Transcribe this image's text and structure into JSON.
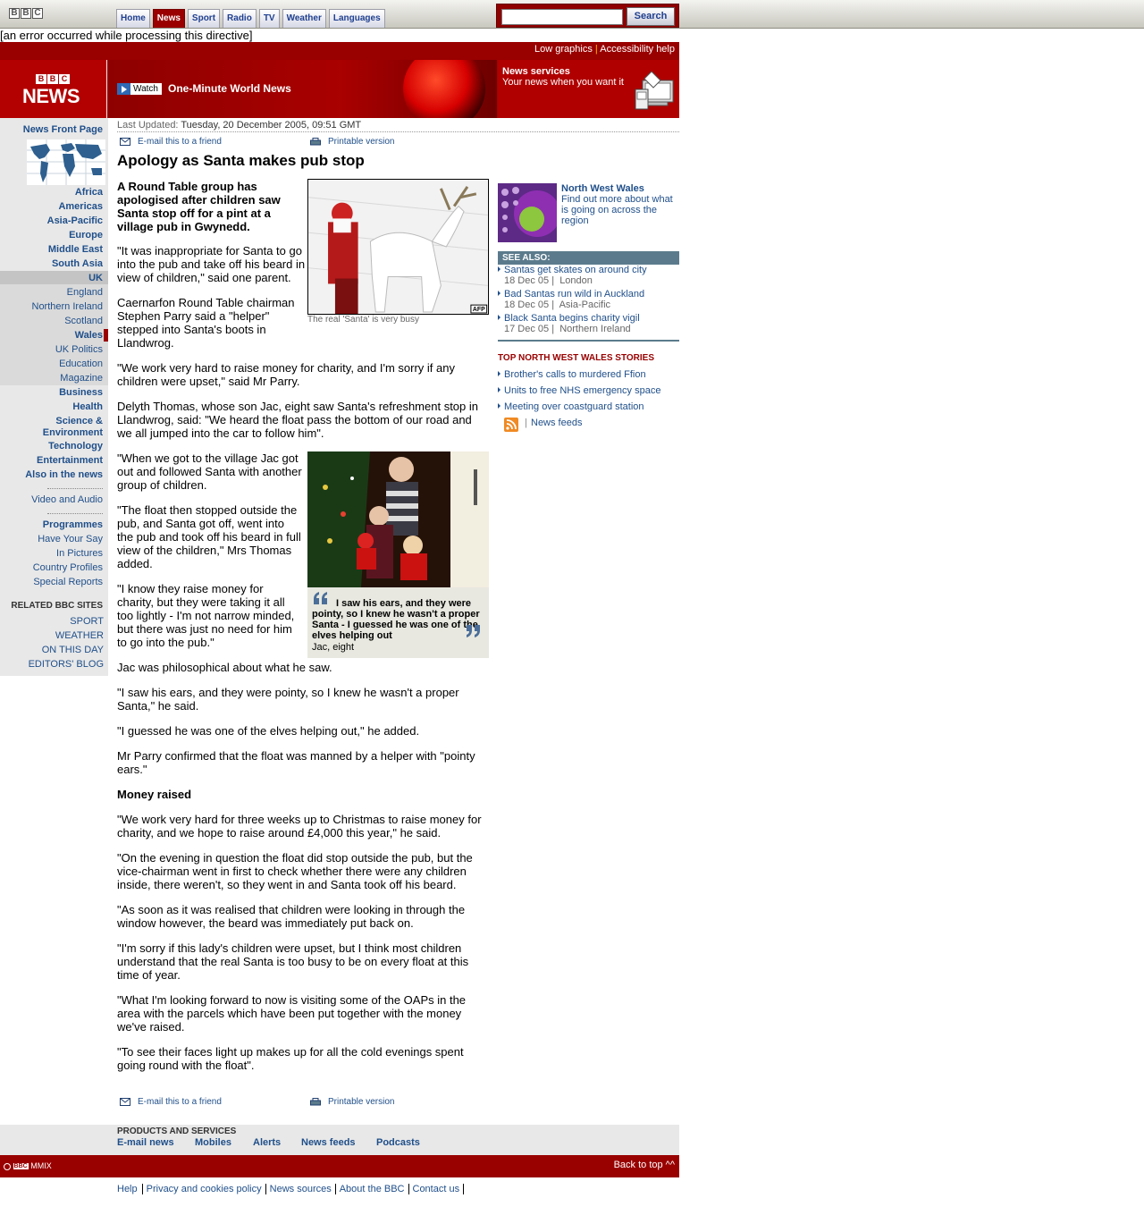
{
  "topnav": {
    "tabs": [
      "Home",
      "News",
      "Sport",
      "Radio",
      "TV",
      "Weather",
      "Languages"
    ],
    "active": "News",
    "search_button": "Search"
  },
  "error_message": "[an error occurred while processing this directive]",
  "utility": {
    "low_graphics": "Low graphics",
    "separator": "|",
    "accessibility": "Accessibility help"
  },
  "masthead": {
    "watch_label": "Watch",
    "watch_title": "One-Minute World News",
    "services_title": "News services",
    "services_sub": "Your news when you want it"
  },
  "leftnav": {
    "front_page": "News Front Page",
    "regions": [
      "Africa",
      "Americas",
      "Asia-Pacific",
      "Europe",
      "Middle East",
      "South Asia",
      "UK"
    ],
    "uk_sub": [
      "England",
      "Northern Ireland",
      "Scotland",
      "Wales",
      "UK Politics",
      "Education",
      "Magazine"
    ],
    "sections": [
      "Business",
      "Health",
      "Science & Environment",
      "Technology",
      "Entertainment",
      "Also in the news"
    ],
    "video_audio": "Video and Audio",
    "programmes": "Programmes",
    "extras": [
      "Have Your Say",
      "In Pictures",
      "Country Profiles",
      "Special Reports"
    ],
    "related_head": "RELATED BBC SITES",
    "related": [
      "SPORT",
      "WEATHER",
      "ON THIS DAY",
      "EDITORS' BLOG"
    ]
  },
  "article": {
    "last_updated_label": "Last Updated:",
    "last_updated": "Tuesday, 20 December 2005, 09:51 GMT",
    "email_link": "E-mail this to a friend",
    "print_link": "Printable version",
    "headline": "Apology as Santa makes pub stop",
    "intro": "A Round Table group has apologised after children saw Santa stop off for a pint at a village pub in Gwynedd.",
    "p1": "\"It was inappropriate for Santa to go into the pub and take off his beard in view of children,\" said one parent.",
    "p2": "Caernarfon Round Table chairman Stephen Parry said a \"helper\" stepped into Santa's boots in Llandwrog.",
    "p3": "\"We work very hard to raise money for charity, and I'm sorry if any children were upset,\" said Mr Parry.",
    "p4": "Delyth Thomas, whose son Jac, eight saw Santa's refreshment stop in Llandwrog, said: \"We heard the float pass the bottom of our road and we all jumped into the car to follow him\".",
    "p5": "\"When we got to the village Jac got out and followed Santa with another group of children.",
    "p6": "\"The float then stopped outside the pub, and Santa got off, went into the pub and took off his beard in full view of the children,\" Mrs Thomas added.",
    "p7": "\"I know they raise money for charity, but they were taking it all too lightly - I'm not narrow minded, but there was just no need for him to go into the pub.\"",
    "p8": "Jac was philosophical about what he saw.",
    "p9": "\"I saw his ears, and they were pointy, so I knew he wasn't a proper Santa,\" he said.",
    "p10": "\"I guessed he was one of the elves helping out,\" he added.",
    "p11": "Mr Parry confirmed that the float was manned by a helper with \"pointy ears.\"",
    "subhead": "Money raised",
    "p12": "\"We work very hard for three weeks up to Christmas to raise money for charity, and we hope to raise around £4,000 this year,\" he said.",
    "p13": "\"On the evening in question the float did stop outside the pub, but the vice-chairman went in first to check whether there were any children inside, there weren't, so they went in and Santa took off his beard.",
    "p14": "\"As soon as it was realised that children were looking in through the window however, the beard was immediately put back on.",
    "p15": "\"I'm sorry if this lady's children were upset, but I think most children understand that the real Santa is too busy to be on every float at this time of year.",
    "p16": "\"What I'm looking forward to now is visiting some of the OAPs in the area with the parcels which have been put together with the money we've raised.",
    "p17": "\"To see their faces light up makes up for all the cold evenings spent going round with the float\".",
    "img1_credit": "AFP",
    "img1_caption": "The real 'Santa' is very busy",
    "quote": "I saw his ears, and they were pointy, so I knew he wasn't a proper Santa - I guessed he was one of the elves helping out",
    "quote_attrib": "Jac, eight"
  },
  "sidebar": {
    "region_title": "North West Wales",
    "region_text": "Find out more about what is going on across the region",
    "see_also_head": "SEE ALSO:",
    "see_also": [
      {
        "title": "Santas get skates on around city",
        "date": "18 Dec 05 |",
        "section": "London"
      },
      {
        "title": "Bad Santas run wild in Auckland",
        "date": "18 Dec 05 |",
        "section": "Asia-Pacific"
      },
      {
        "title": "Black Santa begins charity vigil",
        "date": "17 Dec 05 |",
        "section": "Northern Ireland"
      }
    ],
    "top_stories_head": "TOP NORTH WEST WALES STORIES",
    "top_stories": [
      "Brother's calls to murdered Ffion",
      "Units to free NHS emergency space",
      "Meeting over coastguard station"
    ],
    "feeds_sep": "|",
    "feeds": "News feeds"
  },
  "products": {
    "head": "PRODUCTS AND SERVICES",
    "links": [
      "E-mail news",
      "Mobiles",
      "Alerts",
      "News feeds",
      "Podcasts"
    ]
  },
  "footer": {
    "copyright": "MMIX",
    "back_to_top": "Back to top ^^",
    "links": [
      "Help",
      "Privacy and cookies policy",
      "News sources",
      "About the BBC",
      "Contact us"
    ]
  }
}
